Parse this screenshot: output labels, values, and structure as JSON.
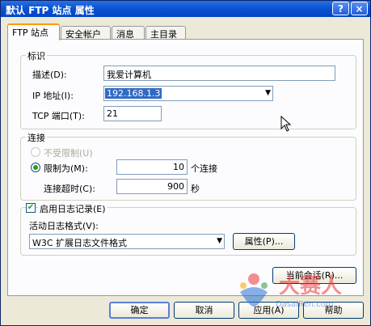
{
  "window": {
    "title": "默认 FTP 站点 属性",
    "help_btn": "?",
    "close_btn": "×"
  },
  "tabs": [
    {
      "label": "FTP 站点",
      "active": true
    },
    {
      "label": "安全帐户",
      "active": false
    },
    {
      "label": "消息",
      "active": false
    },
    {
      "label": "主目录",
      "active": false
    }
  ],
  "identification": {
    "title": "标识",
    "description_label": "描述(D):",
    "description_value": "我爱计算机",
    "ip_label": "IP 地址(I):",
    "ip_value": "192.168.1.3",
    "port_label": "TCP 端口(T):",
    "port_value": "21"
  },
  "connections": {
    "title": "连接",
    "unlimited_label": "不受限制(U)",
    "unlimited_selected": false,
    "limited_label": "限制为(M):",
    "limited_selected": true,
    "limit_value": "10",
    "limit_unit": "个连接",
    "timeout_label": "连接超时(C):",
    "timeout_value": "900",
    "timeout_unit": "秒"
  },
  "logging": {
    "enable_label": "启用日志记录(E)",
    "enabled": true,
    "format_label": "活动日志格式(V):",
    "format_value": "W3C 扩展日志文件格式",
    "properties_btn": "属性(P)..."
  },
  "current_sessions_btn": "当前会话(R)...",
  "buttons": {
    "ok": "确定",
    "cancel": "取消",
    "apply": "应用(A)",
    "help": "帮助"
  },
  "watermark": {
    "text": "大赛人",
    "url": "DasaiRen.com"
  },
  "colors": {
    "titlebar": "#0a54d3",
    "accent_tab": "#ff9a00",
    "selection": "#316ac5"
  }
}
